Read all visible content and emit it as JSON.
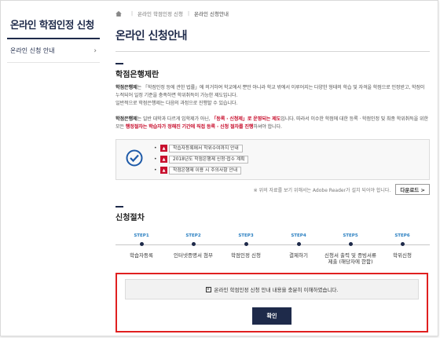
{
  "sidebar": {
    "title": "온라인 학점인정 신청",
    "items": [
      {
        "label": "온라인 신청 안내"
      }
    ]
  },
  "breadcrumb": {
    "items": [
      "온라인 학점인정 신청",
      "온라인 신청안내"
    ]
  },
  "page_title": "온라인 신청안내",
  "section1": {
    "title": "학점은행제란",
    "para1": {
      "lead": "학점은행제",
      "text": "는 「학점인정 등에 관한 법률」에 의거하여 학교에서 뿐만 아니라 학교 밖에서 이루어지는 다양한 형태의 학습 및 자격을 학점으로 인정받고, 학점이 누적되어 일정 기준을 충족하면 학위취득이 가능한 제도입니다.",
      "line2": "일반적으로 학점은행제는 다음의 과정으로 진행할 수 있습니다."
    },
    "para2": {
      "lead": "학점은행제",
      "text_a": "는 일반 대학과 다르게 입학제가 아닌, ",
      "red_a": "「등록 · 신청제」로 운영되는 제도",
      "text_b": "입니다. 따라서 이수한 학점에 대한 등록 · 학점인정 및 최종 학위취득을 위한 모든 ",
      "red_b": "행정절차는 학습자가 정해진 기간에 직접 등록 · 신청 절차를 진행",
      "text_c": "하셔야 합니다."
    },
    "downloads": [
      {
        "label": "학습자등록에서 학위수여까지 안내"
      },
      {
        "label": "2018년도 학점은행제 신청·접수 계획"
      },
      {
        "label": "학점은행제 이용 시 주의사항 안내"
      }
    ],
    "reader_note": "※ 위의 자료를 보기 위해서는 Adobe Reader가 설치 되어야 합니다.",
    "download_button": "다운로드 >"
  },
  "section2": {
    "title": "신청절차",
    "steps": [
      {
        "label": "STEP1",
        "name": "학습자등록"
      },
      {
        "label": "STEP2",
        "name": "인터넷증명서 첨부"
      },
      {
        "label": "STEP3",
        "name": "학점인정 신청"
      },
      {
        "label": "STEP4",
        "name": "결제하기"
      },
      {
        "label": "STEP5",
        "name": "신청서 출력 및 증빙서류 제출 (해당자에 한함)"
      },
      {
        "label": "STEP6",
        "name": "학위신청"
      }
    ]
  },
  "confirm": {
    "checkbox_mark": "V",
    "text": "온라인 학점인정 신청 안내 내용을 충분히 이해하였습니다.",
    "button": "확인"
  },
  "colors": {
    "navy": "#1e2a4a",
    "red": "#c8102e",
    "highlight": "#e02020",
    "step_blue": "#2a7fc1"
  }
}
